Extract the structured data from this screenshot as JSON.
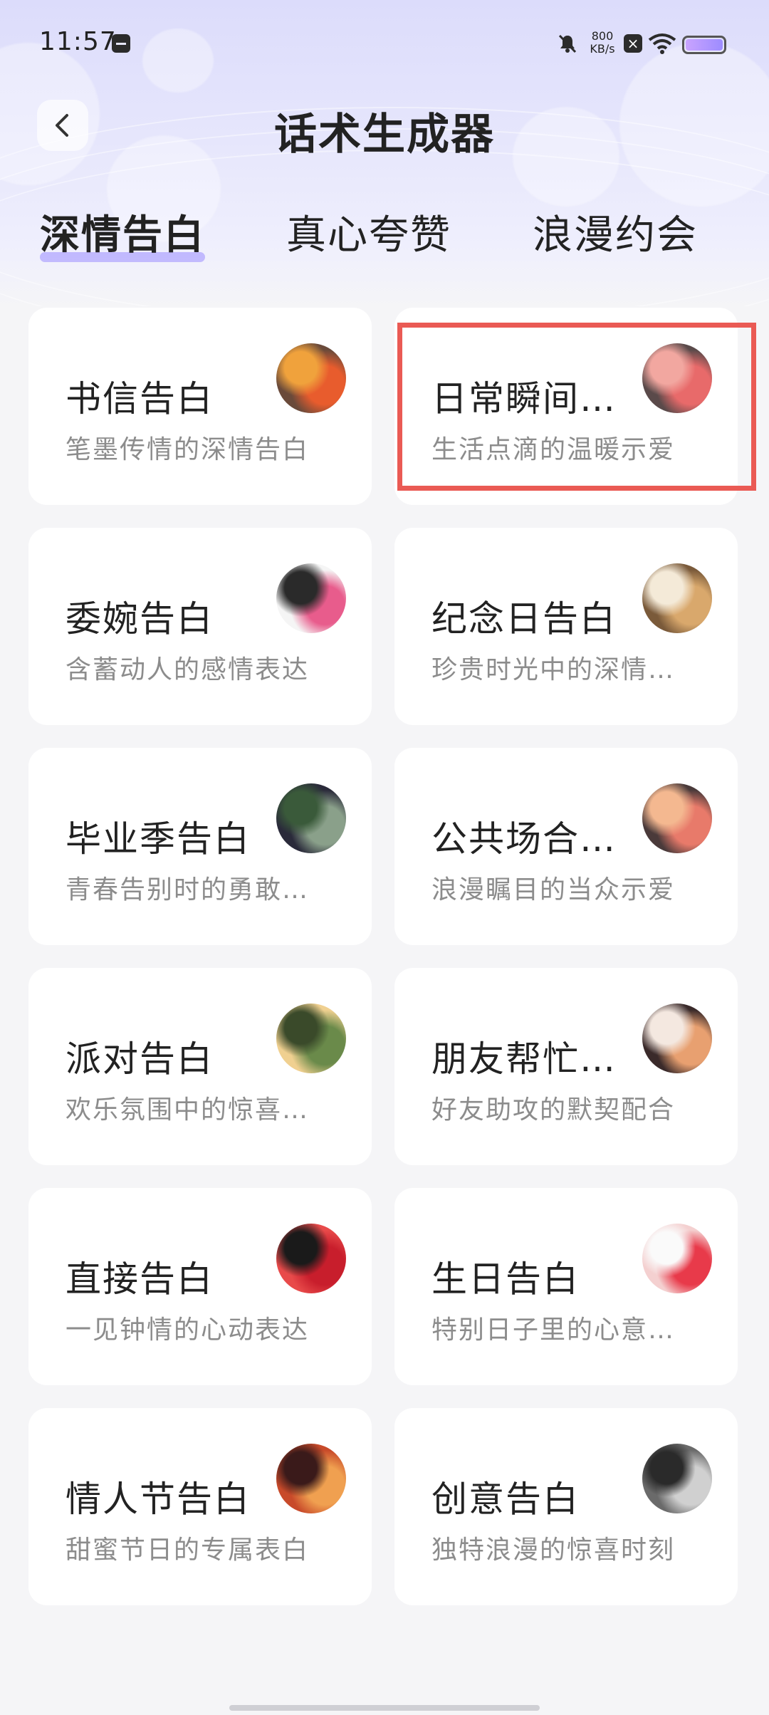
{
  "status_bar": {
    "time": "11:57",
    "net_speed_value": "800",
    "net_speed_unit": "KB/s",
    "x_badge": "×"
  },
  "header": {
    "title": "话术生成器"
  },
  "tabs": [
    {
      "label": "深情告白",
      "active": true
    },
    {
      "label": "真心夸赞",
      "active": false
    },
    {
      "label": "浪漫约会",
      "active": false
    }
  ],
  "cards": [
    {
      "title": "书信告白",
      "subtitle": "笔墨传情的深情告白",
      "thumb_colors": [
        "#f0a23c",
        "#e85c2d",
        "#6a4a3a"
      ]
    },
    {
      "title": "日常瞬间…",
      "subtitle": "生活点滴的温暖示爱",
      "thumb_colors": [
        "#f2a7a0",
        "#e86a6a",
        "#5a4a4a"
      ]
    },
    {
      "title": "委婉告白",
      "subtitle": "含蓄动人的感情表达",
      "thumb_colors": [
        "#2a2a2a",
        "#e85c8c",
        "#f5f5f5"
      ]
    },
    {
      "title": "纪念日告白",
      "subtitle": "珍贵时光中的深情…",
      "thumb_colors": [
        "#f4ead8",
        "#d9a86c",
        "#7a5a3a"
      ]
    },
    {
      "title": "毕业季告白",
      "subtitle": "青春告别时的勇敢…",
      "thumb_colors": [
        "#3a5a3a",
        "#8aa08a",
        "#2a2a3a"
      ]
    },
    {
      "title": "公共场合…",
      "subtitle": "浪漫瞩目的当众示爱",
      "thumb_colors": [
        "#f4b890",
        "#e87a6a",
        "#4a3a3a"
      ]
    },
    {
      "title": "派对告白",
      "subtitle": "欢乐氛围中的惊喜…",
      "thumb_colors": [
        "#3a4a2a",
        "#6a8a4a",
        "#f0d090"
      ]
    },
    {
      "title": "朋友帮忙…",
      "subtitle": "好友助攻的默契配合",
      "thumb_colors": [
        "#f4e8e0",
        "#e8a070",
        "#3a2a2a"
      ]
    },
    {
      "title": "直接告白",
      "subtitle": "一见钟情的心动表达",
      "thumb_colors": [
        "#1a1a1a",
        "#c81e2c",
        "#e84a4a"
      ]
    },
    {
      "title": "生日告白",
      "subtitle": "特别日子里的心意…",
      "thumb_colors": [
        "#fafafa",
        "#e83a4a",
        "#f4d0d0"
      ]
    },
    {
      "title": "情人节告白",
      "subtitle": "甜蜜节日的专属表白",
      "thumb_colors": [
        "#3a1a1a",
        "#f0a050",
        "#c84a2a"
      ]
    },
    {
      "title": "创意告白",
      "subtitle": "独特浪漫的惊喜时刻",
      "thumb_colors": [
        "#2a2a2a",
        "#d0d0d0",
        "#6a6a6a"
      ]
    }
  ]
}
